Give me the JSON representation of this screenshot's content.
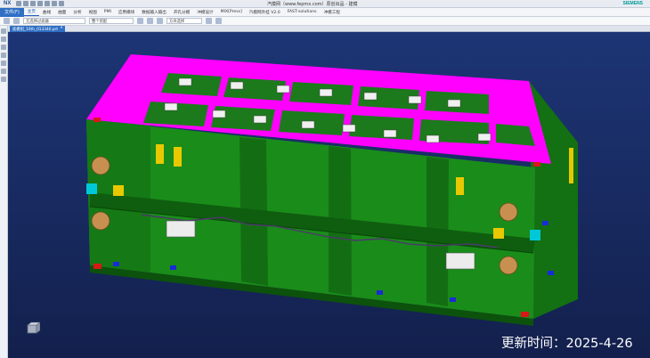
{
  "app": {
    "logo": "NX",
    "title": "汽模网（www.fepmx.com）原创出品 - 建模",
    "brand": "SIEMENS"
  },
  "menubar": {
    "file": "文件(F)",
    "items": [
      "主页",
      "曲线",
      "曲面",
      "分析",
      "视图",
      "PMI",
      "应用模块",
      "数据输入输出",
      "开孔分模",
      "冲模设计",
      "MIX[Press]",
      "汽模网外挂 V2.0",
      "FAST-solutions",
      "冲模工程"
    ]
  },
  "ribbon": {
    "filter": "无选择过滤器",
    "assembly": "整个装配",
    "snap": "方块选择"
  },
  "document": {
    "tab_label": "底模组_10th_013340.prt",
    "close_glyph": "×"
  },
  "overlay": {
    "timestamp": "更新时间：2025-4-26"
  },
  "colors": {
    "viewport_top": "#1d3575",
    "viewport_bottom": "#13204d",
    "body_green": "#1a8c1a",
    "top_plate": "#ff00ff",
    "accent_yellow": "#e8c800",
    "accent_red": "#d81818",
    "accent_blue": "#1a2ad8",
    "accent_cyan": "#00c8d8",
    "accent_bronze": "#c89050"
  }
}
